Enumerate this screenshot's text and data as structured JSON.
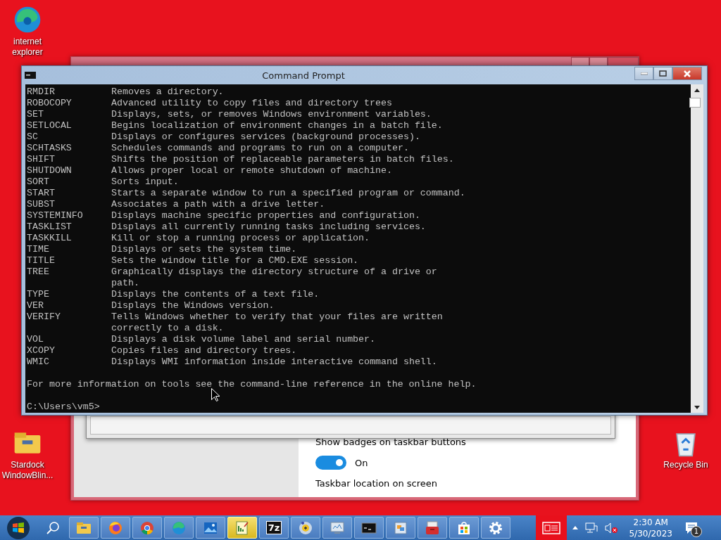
{
  "desktop_icons": [
    {
      "kind": "browser",
      "label": "internet explorer"
    },
    {
      "kind": "folder",
      "label": "Stardock WindowBlin..."
    },
    {
      "kind": "recycle",
      "label": "Recycle Bin"
    }
  ],
  "settings_window": {
    "settings": [
      {
        "kind": "toggle",
        "label": "Show badges on taskbar buttons",
        "on": true,
        "state_label": "On"
      },
      {
        "kind": "heading",
        "label": "Taskbar location on screen"
      }
    ]
  },
  "command_prompt": {
    "title": "Command Prompt",
    "lines": [
      {
        "command": "RMDIR",
        "description": "Removes a directory."
      },
      {
        "command": "ROBOCOPY",
        "description": "Advanced utility to copy files and directory trees"
      },
      {
        "command": "SET",
        "description": "Displays, sets, or removes Windows environment variables."
      },
      {
        "command": "SETLOCAL",
        "description": "Begins localization of environment changes in a batch file."
      },
      {
        "command": "SC",
        "description": "Displays or configures services (background processes)."
      },
      {
        "command": "SCHTASKS",
        "description": "Schedules commands and programs to run on a computer."
      },
      {
        "command": "SHIFT",
        "description": "Shifts the position of replaceable parameters in batch files."
      },
      {
        "command": "SHUTDOWN",
        "description": "Allows proper local or remote shutdown of machine."
      },
      {
        "command": "SORT",
        "description": "Sorts input."
      },
      {
        "command": "START",
        "description": "Starts a separate window to run a specified program or command."
      },
      {
        "command": "SUBST",
        "description": "Associates a path with a drive letter."
      },
      {
        "command": "SYSTEMINFO",
        "description": "Displays machine specific properties and configuration."
      },
      {
        "command": "TASKLIST",
        "description": "Displays all currently running tasks including services."
      },
      {
        "command": "TASKKILL",
        "description": "Kill or stop a running process or application."
      },
      {
        "command": "TIME",
        "description": "Displays or sets the system time."
      },
      {
        "command": "TITLE",
        "description": "Sets the window title for a CMD.EXE session."
      },
      {
        "command": "TREE",
        "description": "Graphically displays the directory structure of a drive or"
      },
      {
        "description": "path."
      },
      {
        "command": "TYPE",
        "description": "Displays the contents of a text file."
      },
      {
        "command": "VER",
        "description": "Displays the Windows version."
      },
      {
        "command": "VERIFY",
        "description": "Tells Windows whether to verify that your files are written"
      },
      {
        "description": "correctly to a disk."
      },
      {
        "command": "VOL",
        "description": "Displays a disk volume label and serial number."
      },
      {
        "command": "XCOPY",
        "description": "Copies files and directory trees."
      },
      {
        "command": "WMIC",
        "description": "Displays WMI information inside interactive command shell."
      }
    ],
    "footer": "For more information on tools see the command-line reference in the online help.",
    "prompt": "C:\\Users\\vm5>"
  },
  "taskbar": {
    "apps": [
      {
        "kind": "folder",
        "selected": false
      },
      {
        "kind": "firefox",
        "selected": false
      },
      {
        "kind": "chrome",
        "selected": false
      },
      {
        "kind": "edge",
        "selected": false
      },
      {
        "kind": "photos",
        "selected": false
      },
      {
        "kind": "notepad",
        "selected": true
      },
      {
        "kind": "archive",
        "label": "7z",
        "selected": false
      },
      {
        "kind": "globe",
        "selected": false
      },
      {
        "kind": "monitor",
        "selected": false
      },
      {
        "kind": "terminal",
        "selected": false
      },
      {
        "kind": "window",
        "selected": false
      },
      {
        "kind": "toolbox",
        "selected": false
      },
      {
        "kind": "store",
        "selected": false
      },
      {
        "kind": "gear",
        "selected": false
      }
    ],
    "clock": {
      "time": "2:30 AM",
      "date": "5/30/2023"
    },
    "notification_count": "1"
  }
}
